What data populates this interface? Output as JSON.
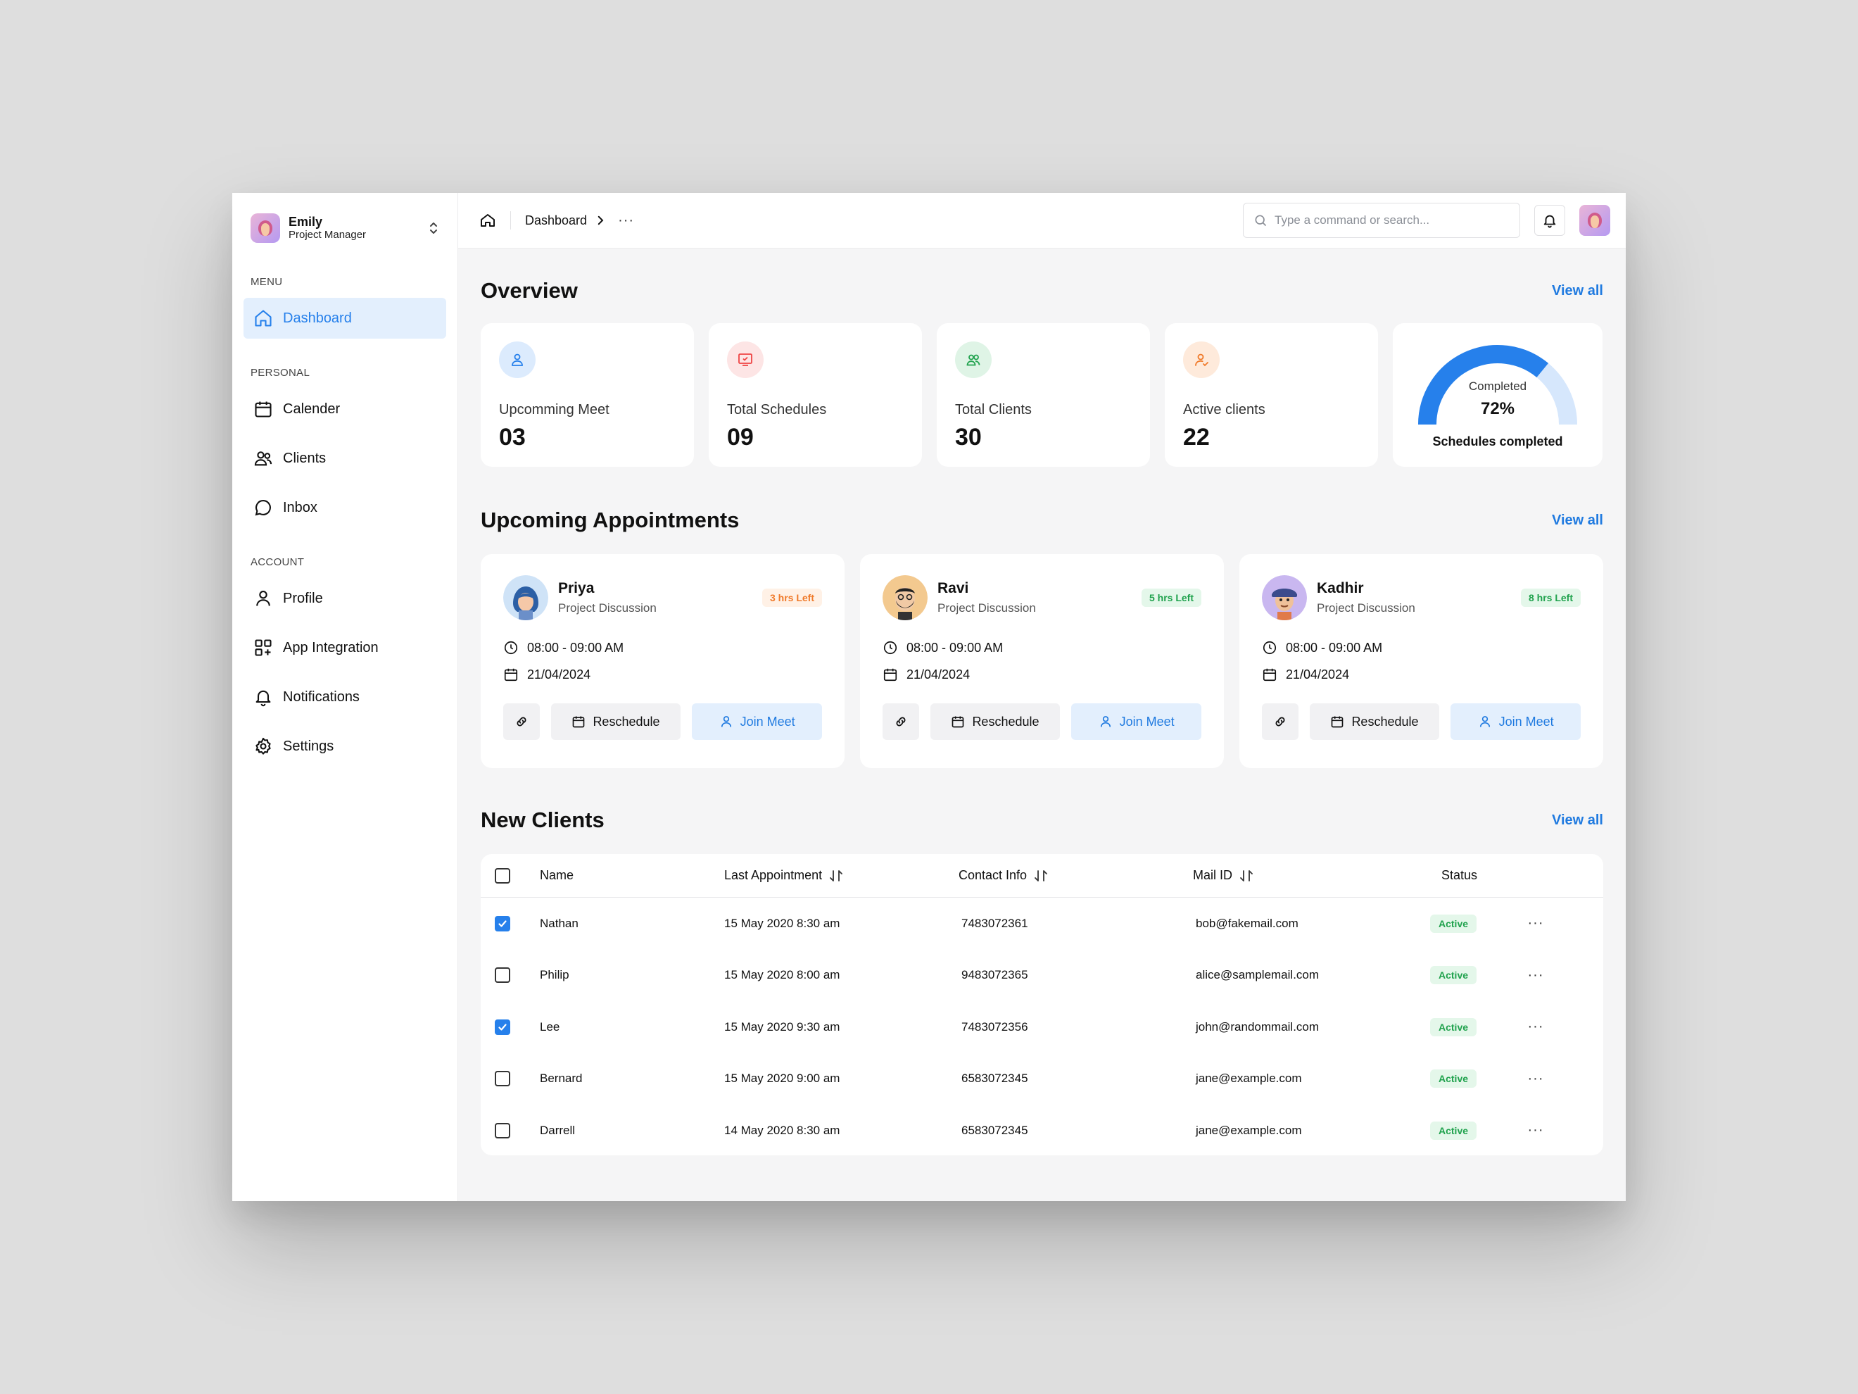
{
  "user": {
    "name": "Emily",
    "role": "Project Manager"
  },
  "sidebar": {
    "menu_label": "MENU",
    "personal_label": "PERSONAL",
    "account_label": "ACCOUNT",
    "items": [
      {
        "label": "Dashboard",
        "icon": "home-icon"
      },
      {
        "label": "Calender",
        "icon": "calendar-icon"
      },
      {
        "label": "Clients",
        "icon": "users-icon"
      },
      {
        "label": "Inbox",
        "icon": "chat-icon"
      },
      {
        "label": "Profile",
        "icon": "user-icon"
      },
      {
        "label": "App Integration",
        "icon": "grid-plus-icon"
      },
      {
        "label": "Notifications",
        "icon": "bell-icon"
      },
      {
        "label": "Settings",
        "icon": "gear-icon"
      }
    ]
  },
  "topbar": {
    "breadcrumb": "Dashboard",
    "more": "···",
    "search_placeholder": "Type a command or search..."
  },
  "overview": {
    "title": "Overview",
    "view_all": "View all",
    "stats": [
      {
        "label": "Upcomming Meet",
        "value": "03",
        "color": "#2680eb"
      },
      {
        "label": "Total Schedules",
        "value": "09",
        "color": "#ef4444"
      },
      {
        "label": "Total Clients",
        "value": "30",
        "color": "#22a34f"
      },
      {
        "label": "Active clients",
        "value": "22",
        "color": "#f07a2a"
      }
    ],
    "gauge": {
      "caption": "Completed",
      "percent_label": "72%",
      "percent": 72,
      "subtitle": "Schedules completed"
    }
  },
  "appointments": {
    "title": "Upcoming Appointments",
    "view_all": "View all",
    "reschedule_label": "Reschedule",
    "join_label": "Join Meet",
    "items": [
      {
        "name": "Priya",
        "topic": "Project Discussion",
        "badge": "3 hrs Left",
        "time": "08:00 - 09:00 AM",
        "date": "21/04/2024"
      },
      {
        "name": "Ravi",
        "topic": "Project Discussion",
        "badge": "5 hrs Left",
        "time": "08:00 - 09:00 AM",
        "date": "21/04/2024"
      },
      {
        "name": "Kadhir",
        "topic": "Project Discussion",
        "badge": "8 hrs Left",
        "time": "08:00 - 09:00 AM",
        "date": "21/04/2024"
      }
    ]
  },
  "clients": {
    "title": "New Clients",
    "view_all": "View all",
    "columns": [
      "Name",
      "Last Appointment",
      "Contact Info",
      "Mail ID",
      "Status"
    ],
    "rows": [
      {
        "checked": true,
        "name": "Nathan",
        "last": "15 May 2020 8:30 am",
        "contact": "7483072361",
        "mail": "bob@fakemail.com",
        "status": "Active"
      },
      {
        "checked": false,
        "name": "Philip",
        "last": "15 May 2020 8:00 am",
        "contact": "9483072365",
        "mail": "alice@samplemail.com",
        "status": "Active"
      },
      {
        "checked": true,
        "name": "Lee",
        "last": "15 May 2020 9:30 am",
        "contact": "7483072356",
        "mail": "john@randommail.com",
        "status": "Active"
      },
      {
        "checked": false,
        "name": "Bernard",
        "last": "15 May 2020 9:00 am",
        "contact": "6583072345",
        "mail": "jane@example.com",
        "status": "Active"
      },
      {
        "checked": false,
        "name": "Darrell",
        "last": "14 May 2020 8:30 am",
        "contact": "6583072345",
        "mail": "jane@example.com",
        "status": "Active"
      }
    ]
  },
  "colors": {
    "accent": "#2680eb",
    "active_green": "#20a24d"
  }
}
